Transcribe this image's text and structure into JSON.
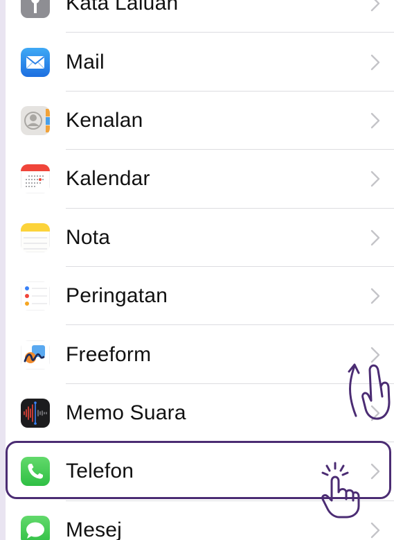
{
  "settings_list": {
    "items": [
      {
        "label": "Kata Laluan",
        "icon": "key-icon"
      },
      {
        "label": "Mail",
        "icon": "mail-icon"
      },
      {
        "label": "Kenalan",
        "icon": "contacts-icon"
      },
      {
        "label": "Kalendar",
        "icon": "calendar-icon"
      },
      {
        "label": "Nota",
        "icon": "notes-icon"
      },
      {
        "label": "Peringatan",
        "icon": "reminders-icon"
      },
      {
        "label": "Freeform",
        "icon": "freeform-icon"
      },
      {
        "label": "Memo Suara",
        "icon": "voice-memos-icon"
      },
      {
        "label": "Telefon",
        "icon": "phone-icon"
      },
      {
        "label": "Mesej",
        "icon": "messages-icon"
      }
    ]
  },
  "annotations": {
    "highlight_color": "#4b2c73",
    "swipe_gesture": "swipe-up-hand-icon",
    "tap_gesture": "tap-hand-icon",
    "highlighted_item": "Telefon"
  },
  "colors": {
    "background": "#e9e4f1",
    "separator": "#dcdce0",
    "chevron": "#c4c4c8"
  }
}
